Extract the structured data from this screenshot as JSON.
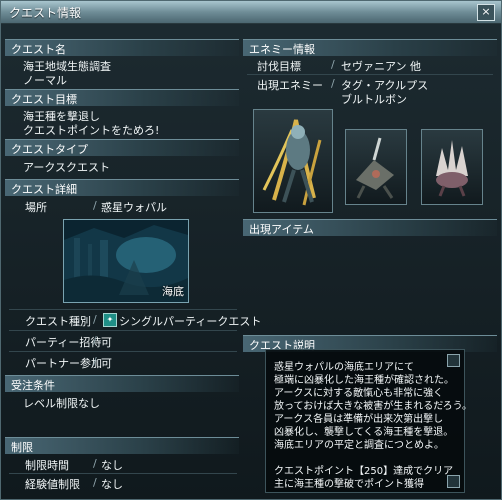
{
  "window": {
    "title": "クエスト情報",
    "close_label": "×"
  },
  "quest_name": {
    "header": "クエスト名",
    "name": "海王地域生態調査",
    "difficulty": "ノーマル"
  },
  "quest_goal": {
    "header": "クエスト目標",
    "line1": "海王種を撃退し",
    "line2": "クエストポイントをためろ!"
  },
  "quest_type": {
    "header": "クエストタイプ",
    "value": "アークスクエスト"
  },
  "quest_detail": {
    "header": "クエスト詳細",
    "location_label": "場所",
    "location_value": "惑星ウォパル",
    "area_name": "海底",
    "kind_label": "クエスト種別",
    "kind_value": "シングルパーティークエスト",
    "party_invite_label": "パーティー招待",
    "party_invite_value": "可",
    "partner_label": "パートナー参加",
    "partner_value": "可"
  },
  "order_conditions": {
    "header": "受注条件",
    "value": "レベル制限なし"
  },
  "limits": {
    "header": "制限",
    "time_label": "制限時間",
    "time_value": "なし",
    "exp_label": "経験値制限",
    "exp_value": "なし"
  },
  "enemy_info": {
    "header": "エネミー情報",
    "target_label": "討伐目標",
    "target_value": "セヴァニアン 他",
    "appear_label": "出現エネミー",
    "appear_line1": "タグ・アクルプス",
    "appear_line2": "ブルトルボン"
  },
  "items": {
    "header": "出現アイテム"
  },
  "description": {
    "header": "クエスト説明",
    "lines": [
      "惑星ウォパルの海底エリアにて",
      "極端に凶暴化した海王種が確認された。",
      "アークスに対する敵愾心も非常に強く",
      "放っておけば大きな被害が生まれるだろう。",
      "アークス各員は準備が出来次第出撃し",
      "凶暴化し、襲撃してくる海王種を撃退。",
      "海底エリアの平定と調査につとめよ。"
    ],
    "reward_line1": "クエストポイント【250】達成でクリア",
    "reward_line2": "主に海王種の撃破でポイント獲得"
  },
  "colors": {
    "accent": "#4b6670",
    "header_bg": "#496774",
    "text": "#f1f6f7"
  }
}
